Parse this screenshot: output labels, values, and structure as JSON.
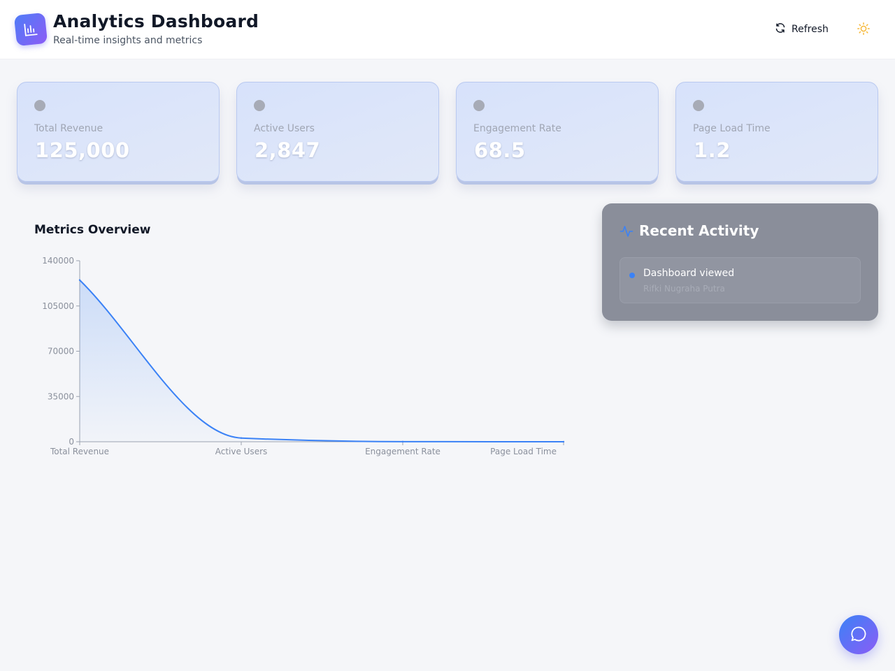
{
  "header": {
    "title": "Analytics Dashboard",
    "subtitle": "Real-time insights and metrics",
    "refresh_label": "Refresh",
    "logo_icon": "bar-chart-icon",
    "theme_icon": "sun-icon"
  },
  "stats": [
    {
      "label": "Total Revenue",
      "value": "125,000"
    },
    {
      "label": "Active Users",
      "value": "2,847"
    },
    {
      "label": "Engagement Rate",
      "value": "68.5"
    },
    {
      "label": "Page Load Time",
      "value": "1.2"
    }
  ],
  "chart": {
    "title": "Metrics Overview"
  },
  "chart_data": {
    "type": "area",
    "categories": [
      "Total Revenue",
      "Active Users",
      "Engagement Rate",
      "Page Load Time"
    ],
    "values": [
      125000,
      2847,
      68.5,
      1.2
    ],
    "yticks": [
      0,
      35000,
      70000,
      105000,
      140000
    ],
    "ylim": [
      0,
      140000
    ],
    "grid": false,
    "colors": {
      "line": "#3b82f6",
      "fill": "#3b82f6"
    }
  },
  "activity": {
    "title": "Recent Activity",
    "icon": "activity-pulse-icon",
    "items": [
      {
        "event": "Dashboard viewed",
        "user": "Rifki Nugraha Putra"
      }
    ]
  },
  "chat": {
    "icon": "chat-bubble-icon"
  },
  "colors": {
    "accent": "#3b82f6",
    "accent_secondary": "#8b5cf6",
    "sun": "#f6b93b"
  }
}
